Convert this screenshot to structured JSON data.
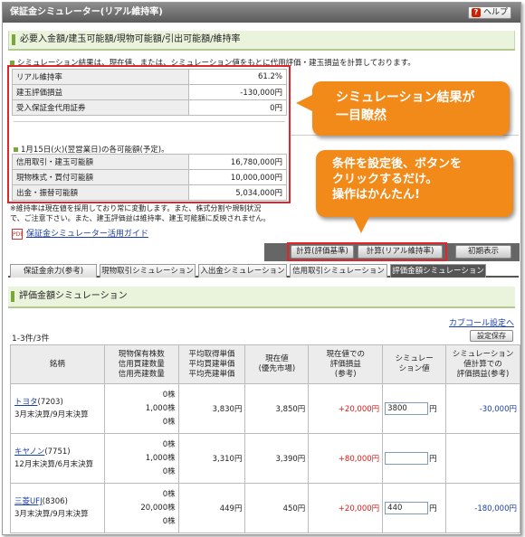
{
  "title": "保証金シミュレーター(リアル維持率)",
  "help_label": "ヘルプ",
  "section_heading": "必要入金額/建玉可能額/現物可能額/引出可能額/維持率",
  "note": "シミュレーション結果は、現在値、または、シミュレーション値をもとに代用評価・建玉損益を計算しております。",
  "sim_rows": [
    {
      "label": "リアル維持率",
      "value": "61.2%"
    },
    {
      "label": "建玉評価損益",
      "value": "-130,000円"
    },
    {
      "label": "受入保証金代用証券",
      "value": "0円"
    }
  ],
  "avail_heading": "1月15日(火)(翌営業日)の各可能額(予定)。",
  "avail_rows": [
    {
      "label": "信用取引・建玉可能額",
      "value": "16,780,000円"
    },
    {
      "label": "現物株式・買付可能額",
      "value": "10,000,000円"
    },
    {
      "label": "出金・振替可能額",
      "value": "5,034,000円"
    }
  ],
  "footnote_1": "※維持率は現在値を採用しており常に変動します。また、株式分割や規制状況",
  "footnote_2": "で、ご注意下さい。また、建玉評価益は維持率、建玉可能額に反映されません。",
  "pdf_icon_text": "PDF",
  "guide_link": "保証金シミュレーター活用ガイド",
  "callout_1_line1": "シミュレーション結果が",
  "callout_1_line2": "一目瞭然",
  "callout_2_line1": "条件を設定後、ボタンを",
  "callout_2_line2": "クリックするだけ。",
  "callout_2_line3": "操作はかんたん!",
  "buttons": {
    "calc_eval": "計算(評価基準)",
    "calc_real": "計算(リアル維持率)",
    "reset": "初期表示"
  },
  "tabs": [
    "保証金余力(参考)",
    "現物取引シミュレーション",
    "入出金シミュレーション",
    "信用取引シミュレーション",
    "評価金額シミュレーション"
  ],
  "section2_heading": "評価金額シミュレーション",
  "kabu_link": "カブコール設定へ",
  "count": "1-3件/3件",
  "save_label": "設定保存",
  "headers": {
    "name": "銘柄",
    "qty_1": "現物保有株数",
    "qty_2": "信用買建数量",
    "qty_3": "信用売建数量",
    "avg_1": "平均取得単価",
    "avg_2": "平均買建単価",
    "avg_3": "平均売建単価",
    "price_1": "現在値",
    "price_2": "(優先市場)",
    "pl_1": "現在値での",
    "pl_2": "評価損益",
    "pl_3": "(参考)",
    "sim_1": "シミュレー",
    "sim_2": "ション値",
    "simpl_1": "シミュレーション",
    "simpl_2": "値計算での",
    "simpl_3": "評価損益(参考)"
  },
  "rows": [
    {
      "name": "トヨタ",
      "code": "(7203)",
      "settle": "3月末決算/9月末決算",
      "qty1": "0株",
      "qty2": "1,000株",
      "qty3": "0株",
      "avg": "3,830円",
      "price": "3,850円",
      "pl": "+20,000円",
      "sim": "3800",
      "simpl": "-30,000円"
    },
    {
      "name": "キヤノン",
      "code": "(7751)",
      "settle": "12月末決算/6月末決算",
      "qty1": "0株",
      "qty2": "1,000株",
      "qty3": "0株",
      "avg": "3,310円",
      "price": "3,390円",
      "pl": "+80,000円",
      "sim": "",
      "simpl": ""
    },
    {
      "name": "三菱UFJ",
      "code": "(8306)",
      "settle": "3月末決算/9月末決算",
      "qty1": "0株",
      "qty2": "20,000株",
      "qty3": "0株",
      "avg": "449円",
      "price": "450円",
      "pl": "+20,000円",
      "sim": "440",
      "simpl": "-180,000円"
    }
  ],
  "yen": "円",
  "colors": {
    "callout": "#f28a1a",
    "highlight": "#e0262a",
    "positive": "#e01818",
    "negative": "#1a3ea8",
    "accent": "#7aa63a"
  }
}
